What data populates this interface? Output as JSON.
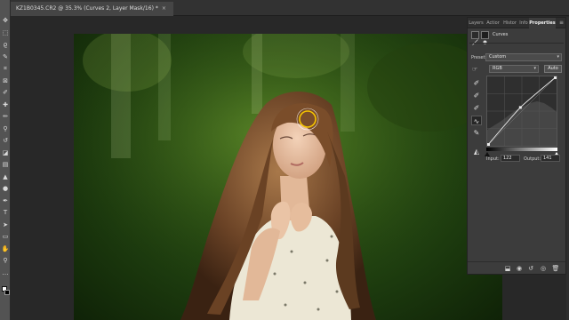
{
  "document": {
    "tab_title": "KZ1B0345.CR2 @ 35.3% (Curves 2, Layer Mask/16) *",
    "close_glyph": "×"
  },
  "toolbar": {
    "tools": [
      {
        "name": "move-tool-icon",
        "glyph": "✥"
      },
      {
        "name": "marquee-tool-icon",
        "glyph": "⬚"
      },
      {
        "name": "lasso-tool-icon",
        "glyph": "ϱ"
      },
      {
        "name": "quick-select-tool-icon",
        "glyph": "✎"
      },
      {
        "name": "crop-tool-icon",
        "glyph": "⌗"
      },
      {
        "name": "frame-tool-icon",
        "glyph": "⊠"
      },
      {
        "name": "eyedropper-tool-icon",
        "glyph": "✐"
      },
      {
        "name": "healing-brush-tool-icon",
        "glyph": "✚"
      },
      {
        "name": "brush-tool-icon",
        "glyph": "✏"
      },
      {
        "name": "clone-stamp-tool-icon",
        "glyph": "⚲"
      },
      {
        "name": "history-brush-tool-icon",
        "glyph": "↺"
      },
      {
        "name": "eraser-tool-icon",
        "glyph": "◪"
      },
      {
        "name": "gradient-tool-icon",
        "glyph": "▤"
      },
      {
        "name": "blur-tool-icon",
        "glyph": "▲"
      },
      {
        "name": "dodge-tool-icon",
        "glyph": "●"
      },
      {
        "name": "pen-tool-icon",
        "glyph": "✒"
      },
      {
        "name": "type-tool-icon",
        "glyph": "T"
      },
      {
        "name": "path-selection-tool-icon",
        "glyph": "➤"
      },
      {
        "name": "rectangle-tool-icon",
        "glyph": "▭"
      },
      {
        "name": "hand-tool-icon",
        "glyph": "✋"
      },
      {
        "name": "zoom-tool-icon",
        "glyph": "⚲"
      },
      {
        "name": "edit-toolbar-icon",
        "glyph": "…"
      }
    ],
    "foreground_color": "#ffffff",
    "background_color": "#000000"
  },
  "panel": {
    "tabs": [
      {
        "label": "Layers",
        "active": false
      },
      {
        "label": "Actior",
        "active": false
      },
      {
        "label": "Histor",
        "active": false
      },
      {
        "label": "Info",
        "active": false
      },
      {
        "label": "Properties",
        "active": true
      }
    ],
    "menu_glyph": "≡",
    "title": "Curves",
    "preset_label": "Preset:",
    "preset_value": "Custom",
    "channel_value": "RGB",
    "auto_label": "Auto",
    "input_label": "Input:",
    "input_value": "122",
    "output_label": "Output:",
    "output_value": "141"
  },
  "curve": {
    "control_point": {
      "input": 122,
      "output": 141
    },
    "range": [
      0,
      255
    ]
  }
}
